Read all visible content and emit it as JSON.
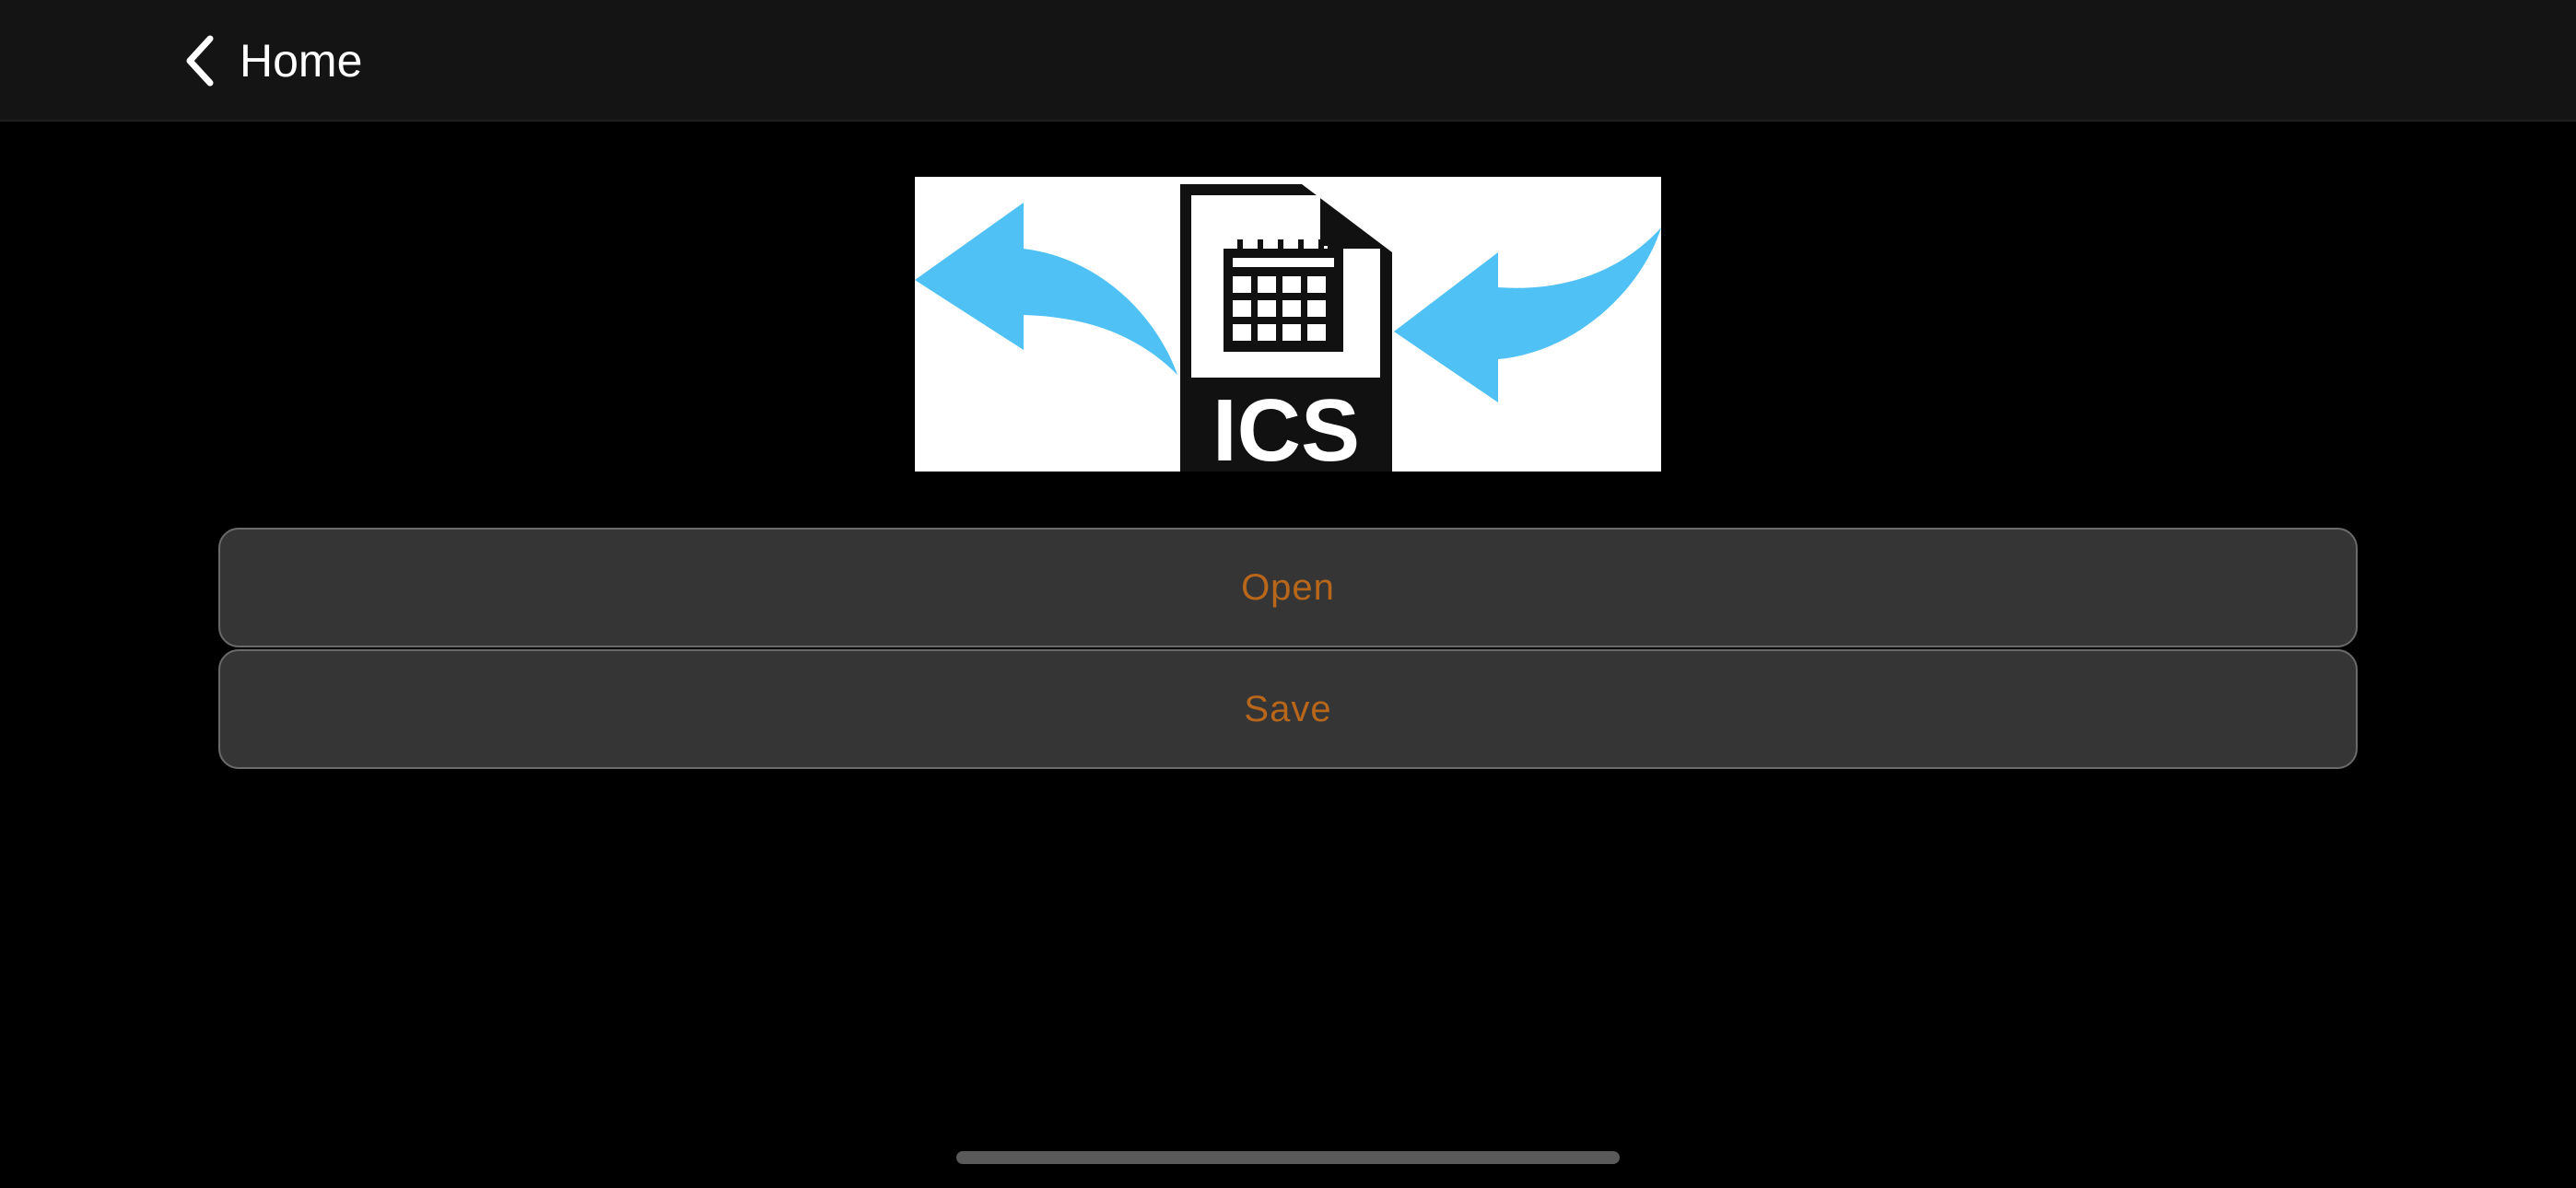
{
  "nav": {
    "back_label": "Home",
    "back_icon": "chevron-left-icon"
  },
  "hero": {
    "file_label": "ICS",
    "arrow_color": "#4fc1f5",
    "icon_color": "#111111"
  },
  "actions": {
    "open_label": "Open",
    "save_label": "Save"
  },
  "colors": {
    "background": "#000000",
    "nav_background": "#141414",
    "button_background": "#353535",
    "button_text": "#b8671a",
    "button_border": "#6a6a6a"
  }
}
